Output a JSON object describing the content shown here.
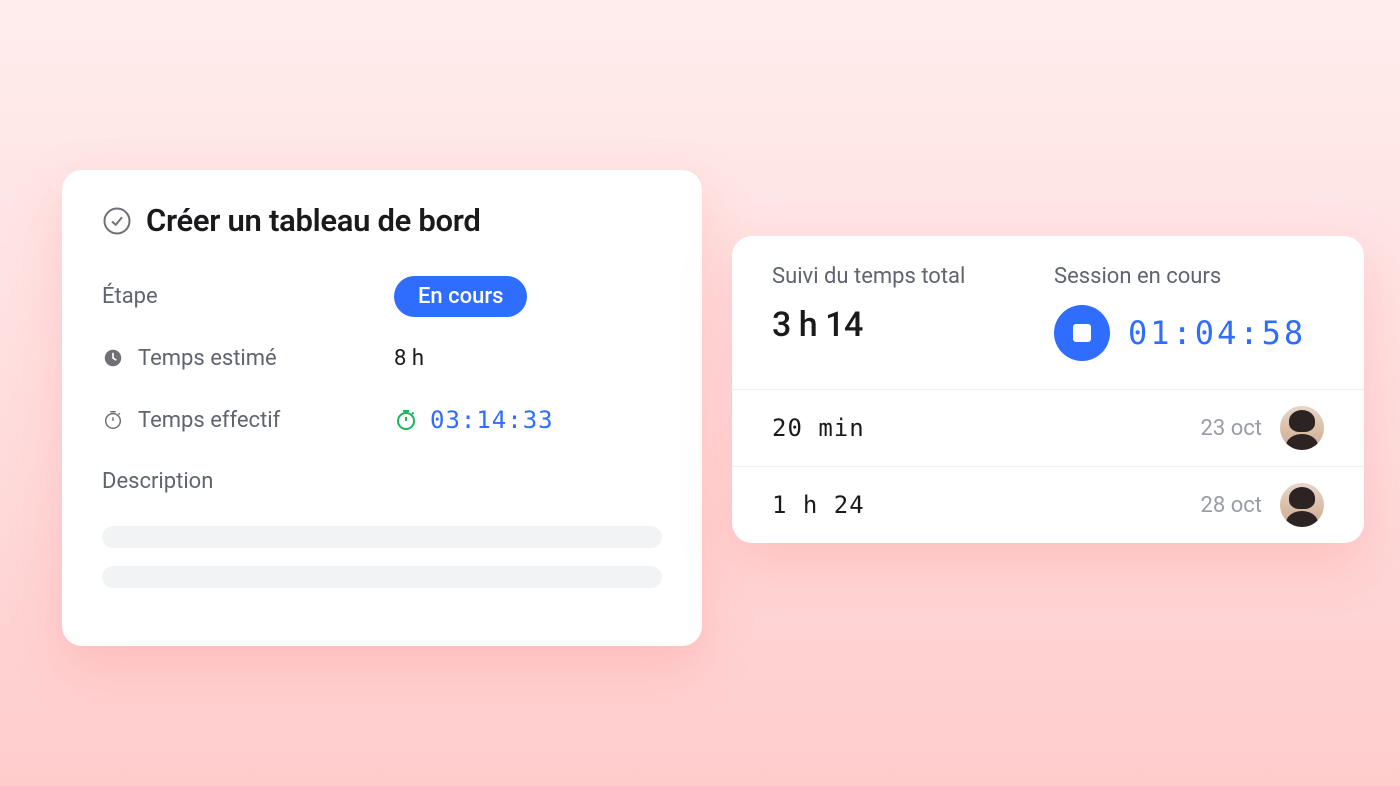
{
  "task": {
    "title": "Créer un tableau de bord",
    "stage_label": "Étape",
    "status_pill": "En cours",
    "estimate_label": "Temps estimé",
    "estimate_value": "8 h",
    "actual_label": "Temps effectif",
    "actual_value": "03:14:33",
    "description_label": "Description"
  },
  "timer": {
    "total_label": "Suivi du temps total",
    "total_value": "3 h 14",
    "session_label": "Session en cours",
    "session_value": "01:04:58",
    "logs": [
      {
        "duration": "20 min",
        "date": "23 oct"
      },
      {
        "duration": "1 h 24",
        "date": "28 oct"
      }
    ]
  },
  "colors": {
    "accent": "#2f6dff",
    "success": "#18b85b"
  }
}
